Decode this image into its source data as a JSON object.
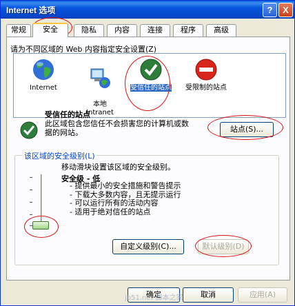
{
  "window": {
    "title": "Internet 选项"
  },
  "titlebar": {
    "help": "?",
    "close": "X"
  },
  "tabs": [
    "常规",
    "安全",
    "隐私",
    "内容",
    "连接",
    "程序",
    "高级"
  ],
  "security": {
    "prompt": "请为不同区域的 Web 内容指定安全设置(Z)",
    "zones": [
      {
        "label": "Internet",
        "icon": "globe-icon"
      },
      {
        "label": "本地\nIntranet",
        "icon": "intranet-icon"
      },
      {
        "label": "受信任的站点",
        "icon": "trusted-check-icon"
      },
      {
        "label": "受限制的站点",
        "icon": "restricted-icon"
      }
    ],
    "selected_title": "受信任的站点",
    "selected_desc": "此区域包含您信任不会损害您的计算机或数据的网站。",
    "sites_button": "站点(S)...",
    "level_group_label": "该区域的安全级别(L)",
    "level_hint": "移动滑块设置该区域的安全级别。",
    "level_name": "安全级 - 低",
    "level_bullets": [
      "- 提供最小的安全措施和警告提示",
      "- 下载大多数内容，且无提示运行",
      "- 可以运行所有的活动内容",
      "- 适用于绝对信任的站点"
    ],
    "custom_button": "自定义级别(C)...",
    "default_button": "默认级别(D)",
    "slider_level": "low"
  },
  "footer": {
    "ok": "确定",
    "cancel": "取消",
    "apply": "应用(A)"
  },
  "watermark": "jb51.net 脚本之家",
  "colors": {
    "titlebar": "#0a5fd8",
    "annotation_red": "#e01010",
    "link_blue": "#0046d5"
  }
}
